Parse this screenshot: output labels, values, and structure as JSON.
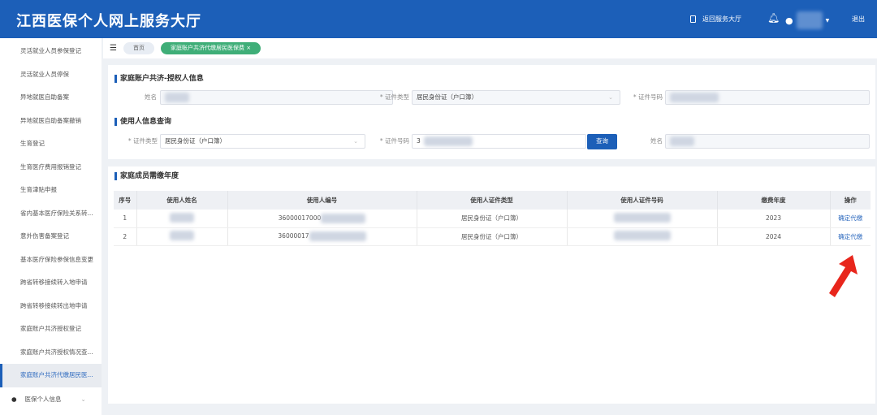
{
  "header": {
    "title": "江西医保个人网上服务大厅",
    "back_link": "返回服务大厅",
    "logout": "退出"
  },
  "sidebar": {
    "items": [
      {
        "label": "灵活就业人员参保登记"
      },
      {
        "label": "灵活就业人员停保"
      },
      {
        "label": "异地就医自助备案"
      },
      {
        "label": "异地就医自助备案撤销"
      },
      {
        "label": "生育登记"
      },
      {
        "label": "生育医疗费用报销登记"
      },
      {
        "label": "生育津贴申报"
      },
      {
        "label": "省内基本医疗保险关系转..."
      },
      {
        "label": "意外伤害备案登记"
      },
      {
        "label": "基本医疗保险参保信息变更"
      },
      {
        "label": "跨省转移接续转入地申请"
      },
      {
        "label": "跨省转移接续转出地申请"
      },
      {
        "label": "家庭账户共济授权登记"
      },
      {
        "label": "家庭账户共济授权情况查..."
      },
      {
        "label": "家庭账户共济代缴居民医..."
      }
    ],
    "group": "医保个人信息"
  },
  "tabs": {
    "home": "首页",
    "current": "家庭账户共济代缴居民医保费",
    "close": "×"
  },
  "auth": {
    "section_title": "家庭账户共济-授权人信息",
    "name_label": "姓名",
    "idtype_label": "* 证件类型",
    "idtype_value": "居民身份证（户口簿）",
    "idno_label": "* 证件号码"
  },
  "query": {
    "section_title": "使用人信息查询",
    "idtype_label": "* 证件类型",
    "idtype_value": "居民身份证（户口簿）",
    "idno_label": "* 证件号码",
    "idno_value": "3",
    "search_button": "查询",
    "name_label": "姓名"
  },
  "family": {
    "section_title": "家庭成员需缴年度",
    "columns": [
      "序号",
      "使用人姓名",
      "使用人编号",
      "使用人证件类型",
      "使用人证件号码",
      "缴费年度",
      "操作"
    ],
    "rows": [
      {
        "no": "1",
        "code": "36000017000",
        "idtype": "居民身份证（户口簿）",
        "year": "2023",
        "action": "确定代缴"
      },
      {
        "no": "2",
        "code": "36000017",
        "idtype": "居民身份证（户口簿）",
        "year": "2024",
        "action": "确定代缴"
      }
    ]
  },
  "colors": {
    "primary": "#1c5fb8",
    "tab_active": "#3fae78",
    "arrow": "#e8261c"
  }
}
